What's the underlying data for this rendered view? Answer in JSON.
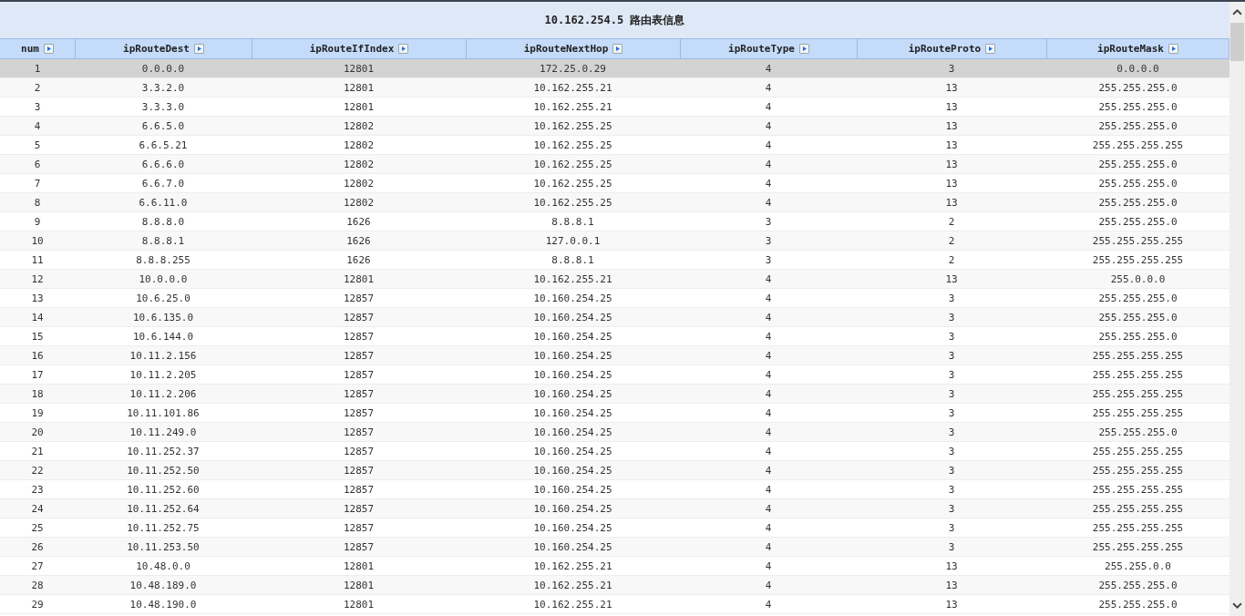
{
  "title": "10.162.254.5 路由表信息",
  "table": {
    "columns": [
      "num",
      "ipRouteDest",
      "ipRouteIfIndex",
      "ipRouteNextHop",
      "ipRouteType",
      "ipRouteProto",
      "ipRouteMask"
    ],
    "rows": [
      {
        "selected": true,
        "cells": [
          "1",
          "0.0.0.0",
          "12801",
          "172.25.0.29",
          "4",
          "3",
          "0.0.0.0"
        ]
      },
      {
        "selected": false,
        "cells": [
          "2",
          "3.3.2.0",
          "12801",
          "10.162.255.21",
          "4",
          "13",
          "255.255.255.0"
        ]
      },
      {
        "selected": false,
        "cells": [
          "3",
          "3.3.3.0",
          "12801",
          "10.162.255.21",
          "4",
          "13",
          "255.255.255.0"
        ]
      },
      {
        "selected": false,
        "cells": [
          "4",
          "6.6.5.0",
          "12802",
          "10.162.255.25",
          "4",
          "13",
          "255.255.255.0"
        ]
      },
      {
        "selected": false,
        "cells": [
          "5",
          "6.6.5.21",
          "12802",
          "10.162.255.25",
          "4",
          "13",
          "255.255.255.255"
        ]
      },
      {
        "selected": false,
        "cells": [
          "6",
          "6.6.6.0",
          "12802",
          "10.162.255.25",
          "4",
          "13",
          "255.255.255.0"
        ]
      },
      {
        "selected": false,
        "cells": [
          "7",
          "6.6.7.0",
          "12802",
          "10.162.255.25",
          "4",
          "13",
          "255.255.255.0"
        ]
      },
      {
        "selected": false,
        "cells": [
          "8",
          "6.6.11.0",
          "12802",
          "10.162.255.25",
          "4",
          "13",
          "255.255.255.0"
        ]
      },
      {
        "selected": false,
        "cells": [
          "9",
          "8.8.8.0",
          "1626",
          "8.8.8.1",
          "3",
          "2",
          "255.255.255.0"
        ]
      },
      {
        "selected": false,
        "cells": [
          "10",
          "8.8.8.1",
          "1626",
          "127.0.0.1",
          "3",
          "2",
          "255.255.255.255"
        ]
      },
      {
        "selected": false,
        "cells": [
          "11",
          "8.8.8.255",
          "1626",
          "8.8.8.1",
          "3",
          "2",
          "255.255.255.255"
        ]
      },
      {
        "selected": false,
        "cells": [
          "12",
          "10.0.0.0",
          "12801",
          "10.162.255.21",
          "4",
          "13",
          "255.0.0.0"
        ]
      },
      {
        "selected": false,
        "cells": [
          "13",
          "10.6.25.0",
          "12857",
          "10.160.254.25",
          "4",
          "3",
          "255.255.255.0"
        ]
      },
      {
        "selected": false,
        "cells": [
          "14",
          "10.6.135.0",
          "12857",
          "10.160.254.25",
          "4",
          "3",
          "255.255.255.0"
        ]
      },
      {
        "selected": false,
        "cells": [
          "15",
          "10.6.144.0",
          "12857",
          "10.160.254.25",
          "4",
          "3",
          "255.255.255.0"
        ]
      },
      {
        "selected": false,
        "cells": [
          "16",
          "10.11.2.156",
          "12857",
          "10.160.254.25",
          "4",
          "3",
          "255.255.255.255"
        ]
      },
      {
        "selected": false,
        "cells": [
          "17",
          "10.11.2.205",
          "12857",
          "10.160.254.25",
          "4",
          "3",
          "255.255.255.255"
        ]
      },
      {
        "selected": false,
        "cells": [
          "18",
          "10.11.2.206",
          "12857",
          "10.160.254.25",
          "4",
          "3",
          "255.255.255.255"
        ]
      },
      {
        "selected": false,
        "cells": [
          "19",
          "10.11.101.86",
          "12857",
          "10.160.254.25",
          "4",
          "3",
          "255.255.255.255"
        ]
      },
      {
        "selected": false,
        "cells": [
          "20",
          "10.11.249.0",
          "12857",
          "10.160.254.25",
          "4",
          "3",
          "255.255.255.0"
        ]
      },
      {
        "selected": false,
        "cells": [
          "21",
          "10.11.252.37",
          "12857",
          "10.160.254.25",
          "4",
          "3",
          "255.255.255.255"
        ]
      },
      {
        "selected": false,
        "cells": [
          "22",
          "10.11.252.50",
          "12857",
          "10.160.254.25",
          "4",
          "3",
          "255.255.255.255"
        ]
      },
      {
        "selected": false,
        "cells": [
          "23",
          "10.11.252.60",
          "12857",
          "10.160.254.25",
          "4",
          "3",
          "255.255.255.255"
        ]
      },
      {
        "selected": false,
        "cells": [
          "24",
          "10.11.252.64",
          "12857",
          "10.160.254.25",
          "4",
          "3",
          "255.255.255.255"
        ]
      },
      {
        "selected": false,
        "cells": [
          "25",
          "10.11.252.75",
          "12857",
          "10.160.254.25",
          "4",
          "3",
          "255.255.255.255"
        ]
      },
      {
        "selected": false,
        "cells": [
          "26",
          "10.11.253.50",
          "12857",
          "10.160.254.25",
          "4",
          "3",
          "255.255.255.255"
        ]
      },
      {
        "selected": false,
        "cells": [
          "27",
          "10.48.0.0",
          "12801",
          "10.162.255.21",
          "4",
          "13",
          "255.255.0.0"
        ]
      },
      {
        "selected": false,
        "cells": [
          "28",
          "10.48.189.0",
          "12801",
          "10.162.255.21",
          "4",
          "13",
          "255.255.255.0"
        ]
      },
      {
        "selected": false,
        "cells": [
          "29",
          "10.48.190.0",
          "12801",
          "10.162.255.21",
          "4",
          "13",
          "255.255.255.0"
        ]
      }
    ]
  }
}
